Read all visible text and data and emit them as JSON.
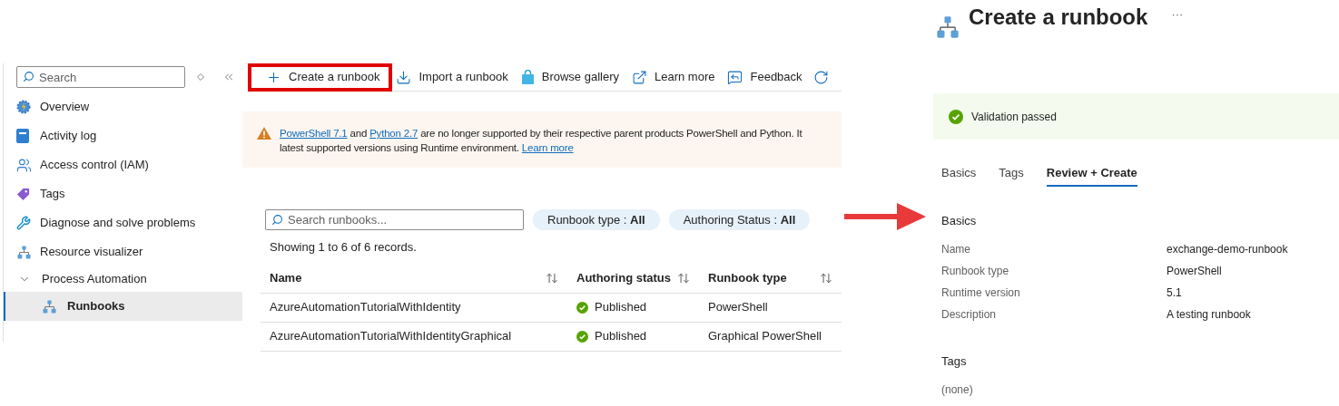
{
  "sidebar": {
    "search": {
      "placeholder": "Search"
    },
    "items": [
      {
        "label": "Overview",
        "selected": false
      },
      {
        "label": "Activity log",
        "selected": false
      },
      {
        "label": "Access control (IAM)",
        "selected": false
      },
      {
        "label": "Tags",
        "selected": false
      },
      {
        "label": "Diagnose and solve problems",
        "selected": false
      },
      {
        "label": "Resource visualizer",
        "selected": false
      }
    ],
    "group": {
      "label": "Process Automation",
      "expanded": true,
      "children": [
        {
          "label": "Runbooks",
          "selected": true
        }
      ]
    }
  },
  "toolbar": [
    {
      "label": "Create a runbook",
      "highlighted": true
    },
    {
      "label": "Import a runbook",
      "highlighted": false
    },
    {
      "label": "Browse gallery",
      "highlighted": false
    },
    {
      "label": "Learn more",
      "highlighted": false
    },
    {
      "label": "Feedback",
      "highlighted": false
    }
  ],
  "warning": {
    "line1": [
      {
        "kind": "link",
        "text": "PowerShell 7.1"
      },
      {
        "kind": "text",
        "text": " and "
      },
      {
        "kind": "link",
        "text": "Python 2.7"
      },
      {
        "kind": "text",
        "text": " are no longer supported by their respective parent products PowerShell and Python. It"
      }
    ],
    "line2": [
      {
        "kind": "text",
        "text": "latest supported versions using Runtime environment. "
      },
      {
        "kind": "link",
        "text": "Learn more"
      }
    ]
  },
  "runbook_search": {
    "placeholder": "Search runbooks..."
  },
  "filters": [
    {
      "label": "Runbook type : ",
      "value": "All"
    },
    {
      "label": "Authoring Status : ",
      "value": "All"
    }
  ],
  "summary": "Showing 1 to 6 of 6 records.",
  "table": {
    "columns": [
      "Name",
      "Authoring status",
      "Runbook type"
    ],
    "rows": [
      {
        "name": "AzureAutomationTutorialWithIdentity",
        "status": "Published",
        "type": "PowerShell"
      },
      {
        "name": "AzureAutomationTutorialWithIdentityGraphical",
        "status": "Published",
        "type": "Graphical PowerShell"
      }
    ]
  },
  "panel": {
    "title": "Create a runbook",
    "more": "···",
    "validation": "Validation passed",
    "tabs": [
      {
        "label": "Basics",
        "selected": false
      },
      {
        "label": "Tags",
        "selected": false
      },
      {
        "label": "Review + Create",
        "selected": true
      }
    ],
    "basics_heading": "Basics",
    "fields": [
      {
        "label": "Name",
        "value": "exchange-demo-runbook"
      },
      {
        "label": "Runbook type",
        "value": "PowerShell"
      },
      {
        "label": "Runtime version",
        "value": "5.1"
      },
      {
        "label": "Description",
        "value": "A testing runbook"
      }
    ],
    "tags_heading": "Tags",
    "tags_value": "(none)"
  }
}
